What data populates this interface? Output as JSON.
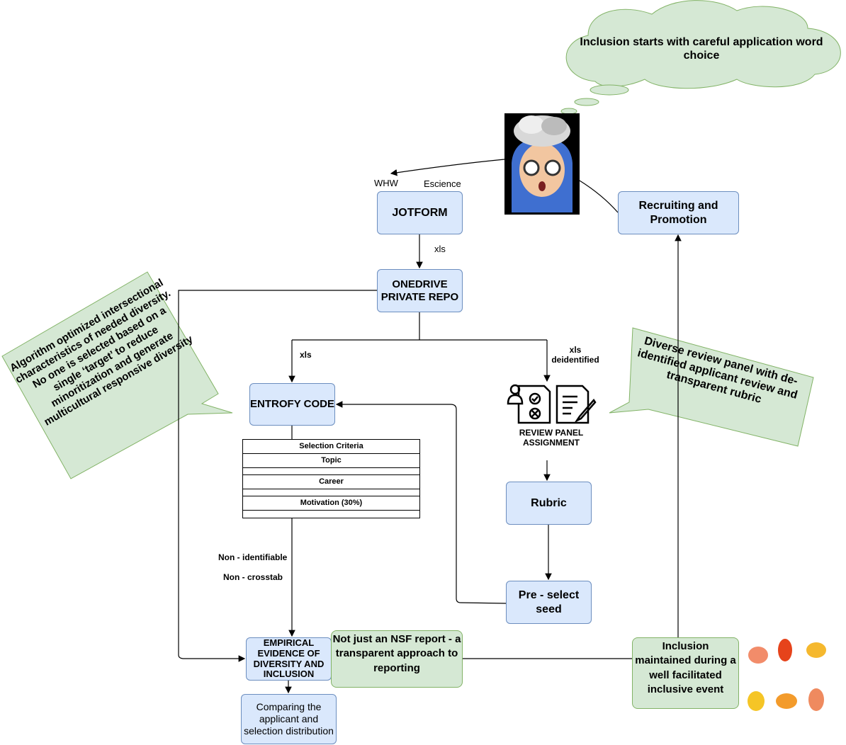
{
  "cloud": {
    "text": "Inclusion starts with careful application word choice"
  },
  "labels": {
    "whw": "WHW",
    "escience": "Escience",
    "xls1": "xls",
    "xls2": "xls",
    "xls_deid": "xls deidentified",
    "non_ident": "Non - identifiable",
    "non_cross": "Non - crosstab",
    "review_panel": "REVIEW PANEL ASSIGNMENT"
  },
  "nodes": {
    "jotform": "JOTFORM",
    "onedrive": "ONEDRIVE PRIVATE REPO",
    "entrofy": "ENTROFY CODE",
    "rubric": "Rubric",
    "preselect": "Pre - select seed",
    "recruiting": "Recruiting and Promotion",
    "empirical": "EMPIRICAL EVIDENCE OF DIVERSITY AND INCLUSION",
    "comparing": "Comparing the applicant and selection distribution"
  },
  "table": {
    "rows": [
      "Selection Criteria",
      "Topic",
      "",
      "Career",
      "",
      "Motivation (30%)",
      ""
    ]
  },
  "notes": {
    "nsf": "Not just an NSF report - a transparent approach to reporting",
    "inclusion": "Inclusion maintained during a well facilitated inclusive event"
  },
  "callouts": {
    "left": "Algorithm optimized intersectional characteristics of needed diversity. No one is selected based on a single ‘target’ to reduce minoritization and generate multicultural responsive diversity",
    "right": "Diverse review panel with de-identified applicant review and transparent rubric"
  },
  "colors": {
    "blue_fill": "#dae8fc",
    "blue_stroke": "#6c8ebf",
    "green_fill": "#d5e8d4",
    "green_stroke": "#82b366"
  }
}
